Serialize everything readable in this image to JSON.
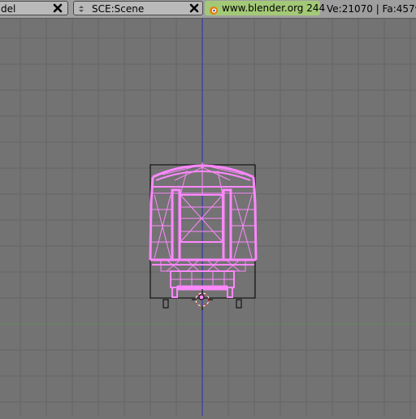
{
  "header": {
    "model_field": {
      "text": "del"
    },
    "scene_field": {
      "text": "SCE:Scene"
    },
    "website_link": {
      "text": "www.blender.org 244"
    },
    "stats": "Ve:21070 | Fa:4579"
  },
  "viewport": {
    "colors": {
      "background": "#737373",
      "grid": "#666666",
      "y_axis": "#2b2bc0",
      "x_axis": "#5c8c5c",
      "mesh": "#ff88ff",
      "bounds": "#000000"
    }
  }
}
